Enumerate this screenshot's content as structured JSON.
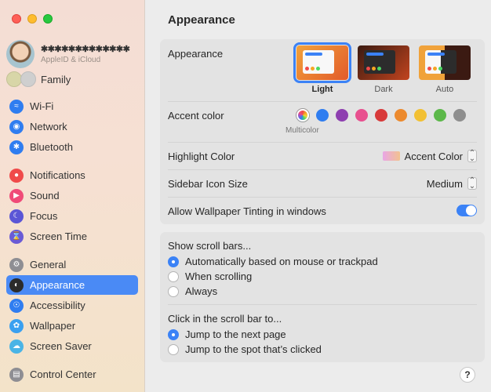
{
  "sidebar": {
    "account": {
      "name": "✱✱✱✱✱✱✱✱✱✱✱✱✱",
      "subtitle": "AppleID & iCloud"
    },
    "family_label": "Family",
    "items": [
      {
        "label": "Wi-Fi",
        "icon": "wifi-icon"
      },
      {
        "label": "Network",
        "icon": "globe-icon"
      },
      {
        "label": "Bluetooth",
        "icon": "bluetooth-icon"
      },
      {
        "label": "Notifications",
        "icon": "bell-icon"
      },
      {
        "label": "Sound",
        "icon": "speaker-icon"
      },
      {
        "label": "Focus",
        "icon": "moon-icon"
      },
      {
        "label": "Screen Time",
        "icon": "hourglass-icon"
      },
      {
        "label": "General",
        "icon": "gear-icon"
      },
      {
        "label": "Appearance",
        "icon": "appearance-icon",
        "selected": true
      },
      {
        "label": "Accessibility",
        "icon": "accessibility-icon"
      },
      {
        "label": "Wallpaper",
        "icon": "flower-icon"
      },
      {
        "label": "Screen Saver",
        "icon": "screensaver-icon"
      },
      {
        "label": "Control Center",
        "icon": "control-center-icon"
      }
    ]
  },
  "main": {
    "title": "Appearance",
    "appearance": {
      "label": "Appearance",
      "options": [
        {
          "label": "Light",
          "selected": true
        },
        {
          "label": "Dark",
          "selected": false
        },
        {
          "label": "Auto",
          "selected": false
        }
      ]
    },
    "accent": {
      "label": "Accent color",
      "multicolor_label": "Multicolor",
      "colors": [
        "multicolor",
        "#2f7df0",
        "#8e3fb0",
        "#e8508f",
        "#d83a3a",
        "#ec8a2e",
        "#f2c033",
        "#5cb84a",
        "#8e8e8e"
      ]
    },
    "highlight": {
      "label": "Highlight Color",
      "value": "Accent Color"
    },
    "sidebar_icon_size": {
      "label": "Sidebar Icon Size",
      "value": "Medium"
    },
    "tinting": {
      "label": "Allow Wallpaper Tinting in windows",
      "on": true
    },
    "scroll_bars": {
      "label": "Show scroll bars...",
      "options": [
        {
          "label": "Automatically based on mouse or trackpad",
          "selected": true
        },
        {
          "label": "When scrolling",
          "selected": false
        },
        {
          "label": "Always",
          "selected": false
        }
      ]
    },
    "scroll_click": {
      "label": "Click in the scroll bar to...",
      "options": [
        {
          "label": "Jump to the next page",
          "selected": true
        },
        {
          "label": "Jump to the spot that’s clicked",
          "selected": false
        }
      ]
    },
    "help_label": "?"
  }
}
